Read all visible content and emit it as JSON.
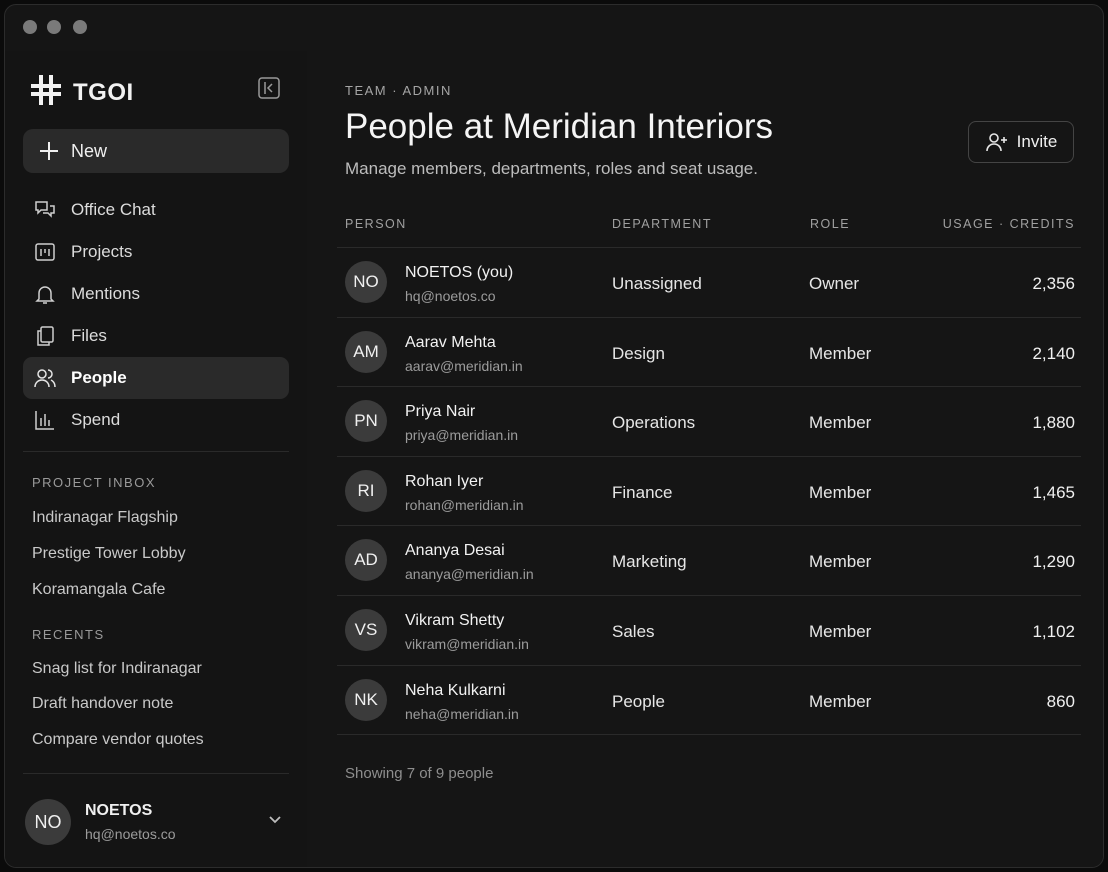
{
  "window": {
    "controls": [
      "close",
      "minimize",
      "maximize"
    ]
  },
  "sidebar": {
    "brand": "TGOI",
    "new_label": "New",
    "nav": [
      {
        "label": "Office Chat",
        "icon": "chat-icon",
        "active": false
      },
      {
        "label": "Projects",
        "icon": "projects-icon",
        "active": false
      },
      {
        "label": "Mentions",
        "icon": "bell-icon",
        "active": false
      },
      {
        "label": "Files",
        "icon": "files-icon",
        "active": false
      },
      {
        "label": "People",
        "icon": "people-icon",
        "active": true
      },
      {
        "label": "Spend",
        "icon": "chart-icon",
        "active": false
      }
    ],
    "project_inbox": {
      "heading": "PROJECT INBOX",
      "items": [
        "Indiranagar Flagship",
        "Prestige Tower Lobby",
        "Koramangala Cafe"
      ]
    },
    "recents": {
      "heading": "RECENTS",
      "items": [
        "Snag list for Indiranagar",
        "Draft handover note",
        "Compare vendor quotes"
      ]
    },
    "user": {
      "initials": "NO",
      "name": "NOETOS",
      "email": "hq@noetos.co"
    }
  },
  "main": {
    "eyebrow": "TEAM · ADMIN",
    "title": "People at Meridian Interiors",
    "subtitle": "Manage members, departments, roles and seat usage.",
    "invite_label": "Invite",
    "columns": {
      "person": "PERSON",
      "department": "DEPARTMENT",
      "role": "ROLE",
      "usage": "USAGE · CREDITS"
    },
    "rows": [
      {
        "initials": "NO",
        "name": "NOETOS (you)",
        "email": "hq@noetos.co",
        "department": "Unassigned",
        "role": "Owner",
        "credits": "2,356"
      },
      {
        "initials": "AM",
        "name": "Aarav Mehta",
        "email": "aarav@meridian.in",
        "department": "Design",
        "role": "Member",
        "credits": "2,140"
      },
      {
        "initials": "PN",
        "name": "Priya Nair",
        "email": "priya@meridian.in",
        "department": "Operations",
        "role": "Member",
        "credits": "1,880"
      },
      {
        "initials": "RI",
        "name": "Rohan Iyer",
        "email": "rohan@meridian.in",
        "department": "Finance",
        "role": "Member",
        "credits": "1,465"
      },
      {
        "initials": "AD",
        "name": "Ananya Desai",
        "email": "ananya@meridian.in",
        "department": "Marketing",
        "role": "Member",
        "credits": "1,290"
      },
      {
        "initials": "VS",
        "name": "Vikram Shetty",
        "email": "vikram@meridian.in",
        "department": "Sales",
        "role": "Member",
        "credits": "1,102"
      },
      {
        "initials": "NK",
        "name": "Neha Kulkarni",
        "email": "neha@meridian.in",
        "department": "People",
        "role": "Member",
        "credits": "860"
      }
    ],
    "footer": "Showing 7 of 9 people"
  },
  "colors": {
    "background": "#151515",
    "surface": "#2a2a2a",
    "text": "#f0f0f0",
    "muted": "#9c9c9c",
    "window_dot": "#7a7a7a"
  }
}
